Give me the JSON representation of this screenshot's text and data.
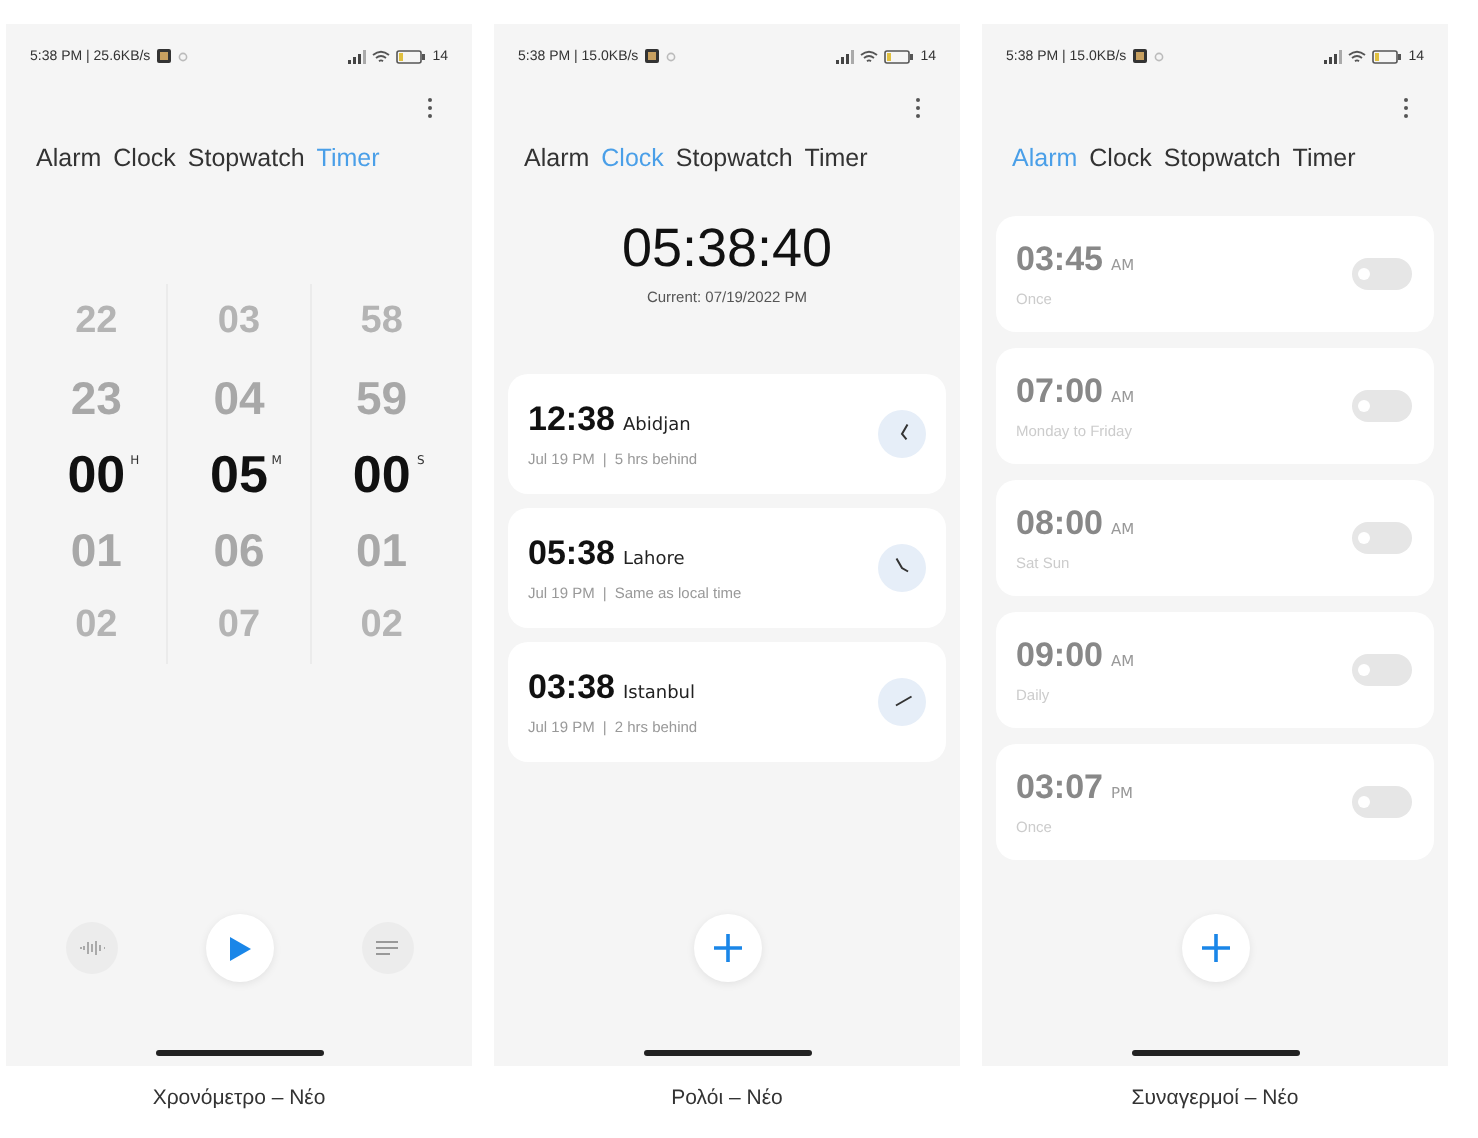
{
  "screens": [
    {
      "kind": "timer",
      "status": {
        "info": "5:38 PM | 25.6KB/s",
        "battery": "14"
      },
      "tabs": [
        {
          "label": "Alarm",
          "selected": false
        },
        {
          "label": "Clock",
          "selected": false
        },
        {
          "label": "Stopwatch",
          "selected": false
        },
        {
          "label": "Timer",
          "selected": true
        }
      ],
      "wheels": [
        {
          "unit": "H",
          "items": [
            {
              "text": "22",
              "selected": false
            },
            {
              "text": "23",
              "selected": false
            },
            {
              "text": "00",
              "selected": true
            },
            {
              "text": "01",
              "selected": false
            },
            {
              "text": "02",
              "selected": false
            }
          ]
        },
        {
          "unit": "M",
          "items": [
            {
              "text": "03",
              "selected": false
            },
            {
              "text": "04",
              "selected": false
            },
            {
              "text": "05",
              "selected": true
            },
            {
              "text": "06",
              "selected": false
            },
            {
              "text": "07",
              "selected": false
            }
          ]
        },
        {
          "unit": "S",
          "items": [
            {
              "text": "58",
              "selected": false
            },
            {
              "text": "59",
              "selected": false
            },
            {
              "text": "00",
              "selected": true
            },
            {
              "text": "01",
              "selected": false
            },
            {
              "text": "02",
              "selected": false
            }
          ]
        }
      ],
      "caption": "Χρονόμετρο – Νέο"
    },
    {
      "kind": "clock",
      "status": {
        "info": "5:38 PM | 15.0KB/s",
        "battery": "14"
      },
      "tabs": [
        {
          "label": "Alarm",
          "selected": false
        },
        {
          "label": "Clock",
          "selected": true
        },
        {
          "label": "Stopwatch",
          "selected": false
        },
        {
          "label": "Timer",
          "selected": false
        }
      ],
      "time": "05:38:40",
      "current": "Current: 07/19/2022 PM",
      "cities": [
        {
          "time": "12:38",
          "city": "Abidjan",
          "date": "Jul 19 PM",
          "separator": "|",
          "diff": "5 hrs behind"
        },
        {
          "time": "05:38",
          "city": "Lahore",
          "date": "Jul 19 PM",
          "separator": "|",
          "diff": "Same as local time"
        },
        {
          "time": "03:38",
          "city": "Istanbul",
          "date": "Jul 19 PM",
          "separator": "|",
          "diff": "2 hrs behind"
        }
      ],
      "caption": "Ρολόι – Νέο"
    },
    {
      "kind": "alarm",
      "status": {
        "info": "5:38 PM | 15.0KB/s",
        "battery": "14"
      },
      "tabs": [
        {
          "label": "Alarm",
          "selected": true
        },
        {
          "label": "Clock",
          "selected": false
        },
        {
          "label": "Stopwatch",
          "selected": false
        },
        {
          "label": "Timer",
          "selected": false
        }
      ],
      "alarms": [
        {
          "time": "03:45",
          "period": "AM",
          "repeat": "Once",
          "on": false
        },
        {
          "time": "07:00",
          "period": "AM",
          "repeat": "Monday to Friday",
          "on": false
        },
        {
          "time": "08:00",
          "period": "AM",
          "repeat": "Sat Sun",
          "on": false
        },
        {
          "time": "09:00",
          "period": "AM",
          "repeat": "Daily",
          "on": false
        },
        {
          "time": "03:07",
          "period": "PM",
          "repeat": "Once",
          "on": false
        }
      ],
      "caption": "Συναγερμοί – Νέο"
    }
  ]
}
